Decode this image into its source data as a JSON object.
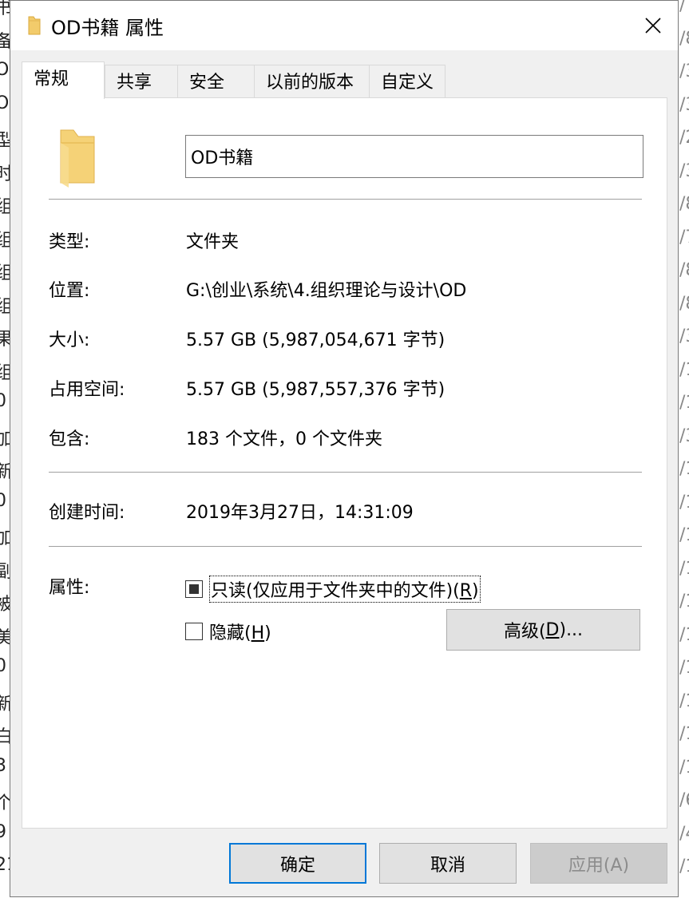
{
  "background_window": {
    "left_fragments": [
      "书",
      "备",
      "OD",
      "OD",
      "型",
      "时",
      "组",
      "组",
      "组",
      "组",
      "果",
      "组",
      "0",
      "加",
      "新",
      "0",
      "加",
      "副",
      "被",
      "美",
      "0",
      "新",
      "白",
      "3",
      "个",
      "9",
      "21"
    ],
    "right_fragments": [
      "/",
      "/8",
      "/3",
      "/3",
      "/2",
      "/3",
      "/8",
      "/7",
      "/8",
      "/8",
      "/3",
      "/1",
      "/1",
      "/3",
      "/1",
      "/1",
      "/1",
      "/1",
      "/1",
      "/1",
      "/1",
      "/1",
      "/1",
      "/1",
      "/6",
      "/4",
      "/1"
    ]
  },
  "dialog": {
    "title": "OD书籍 属性",
    "close_label": "✕"
  },
  "tabs": [
    {
      "label": "常规",
      "active": true
    },
    {
      "label": "共享",
      "active": false
    },
    {
      "label": "安全",
      "active": false
    },
    {
      "label": "以前的版本",
      "active": false
    },
    {
      "label": "自定义",
      "active": false
    }
  ],
  "general": {
    "folder_name": "OD书籍",
    "type_label": "类型:",
    "type_value": "文件夹",
    "location_label": "位置:",
    "location_value": "G:\\创业\\系统\\4.组织理论与设计\\OD",
    "size_label": "大小:",
    "size_value": "5.57 GB (5,987,054,671 字节)",
    "size_on_disk_label": "占用空间:",
    "size_on_disk_value": "5.57 GB (5,987,557,376 字节)",
    "contains_label": "包含:",
    "contains_value": "183 个文件，0 个文件夹",
    "created_label": "创建时间:",
    "created_value": "2019年3月27日，14:31:09",
    "attributes_label": "属性:",
    "readonly_text": "只读(仅应用于文件夹中的文件)(",
    "readonly_key": "R",
    "readonly_close": ")",
    "readonly_state": "indeterminate",
    "hidden_text": "隐藏(",
    "hidden_key": "H",
    "hidden_close": ")",
    "hidden_checked": false,
    "advanced_text": "高级(",
    "advanced_key": "D",
    "advanced_close": ")..."
  },
  "buttons": {
    "ok": "确定",
    "cancel": "取消",
    "apply": "应用(A)"
  },
  "colors": {
    "accent": "#0078d7",
    "folder": "#f2cb6b"
  }
}
